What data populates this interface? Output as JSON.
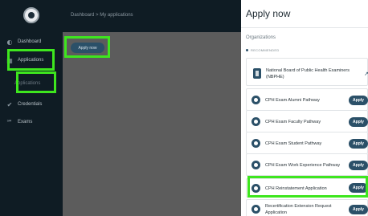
{
  "sidebar": {
    "items": [
      {
        "label": "Dashboard",
        "icon": "dashboard-icon"
      },
      {
        "label": "Applications",
        "icon": "applications-icon"
      },
      {
        "label": "Applications",
        "icon": "sub-applications-icon"
      },
      {
        "label": "Credentials",
        "icon": "credentials-icon"
      },
      {
        "label": "Exams",
        "icon": "exams-icon"
      }
    ]
  },
  "header": {
    "breadcrumb": "Dashboard > My applications"
  },
  "main": {
    "apply_button": "Apply now"
  },
  "panel": {
    "title": "Apply now",
    "section_title": "Organizations",
    "recommended_label": "RECOMMENDED",
    "organization": "National Board of Public Health Examiners (NBPHE)",
    "applications": [
      {
        "name": "CPH Exam Alumni Pathway",
        "action": "Apply"
      },
      {
        "name": "CPH Exam Faculty Pathway",
        "action": "Apply"
      },
      {
        "name": "CPH Exam Student Pathway",
        "action": "Apply"
      },
      {
        "name": "CPH Exam Work Experience Pathway",
        "action": "Apply"
      },
      {
        "name": "CPH Reinstatement Application",
        "action": "Apply"
      },
      {
        "name": "Recertification Extension Request Application",
        "action": "Apply"
      }
    ]
  },
  "colors": {
    "accent": "#2b5068",
    "highlight": "#3ee61e",
    "sidebar": "#0f1c24"
  }
}
